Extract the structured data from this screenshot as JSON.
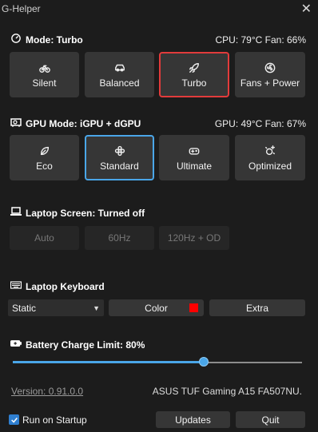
{
  "window": {
    "title": "G-Helper",
    "close_glyph": "✕"
  },
  "mode": {
    "header": "Mode: Turbo",
    "status": "CPU: 79°C Fan: 66%",
    "buttons": [
      {
        "label": "Silent",
        "icon": "bicycle-icon"
      },
      {
        "label": "Balanced",
        "icon": "car-icon"
      },
      {
        "label": "Turbo",
        "icon": "rocket-icon",
        "selected": true
      },
      {
        "label": "Fans + Power",
        "icon": "fan-icon"
      }
    ]
  },
  "gpu": {
    "header": "GPU Mode: iGPU + dGPU",
    "status": "GPU: 49°C Fan: 67%",
    "buttons": [
      {
        "label": "Eco",
        "icon": "leaf-icon"
      },
      {
        "label": "Standard",
        "icon": "flower-icon",
        "selected": true
      },
      {
        "label": "Ultimate",
        "icon": "gamepad-icon"
      },
      {
        "label": "Optimized",
        "icon": "sparkle-icon"
      }
    ]
  },
  "screen": {
    "header": "Laptop Screen: Turned off",
    "buttons": [
      {
        "label": "Auto"
      },
      {
        "label": "60Hz"
      },
      {
        "label": "120Hz + OD"
      }
    ]
  },
  "keyboard": {
    "header": "Laptop Keyboard",
    "mode_value": "Static",
    "color_label": "Color",
    "color_swatch": "#ff0000",
    "extra_label": "Extra"
  },
  "battery": {
    "header": "Battery Charge Limit: 80%",
    "limit_percent": 80
  },
  "footer": {
    "version": "Version: 0.91.0.0",
    "model": "ASUS TUF Gaming A15 FA507NU.",
    "startup_label": "Run on Startup",
    "startup_checked": true,
    "updates_label": "Updates",
    "quit_label": "Quit"
  },
  "colors": {
    "accent_blue": "#4aa6e8",
    "turbo_red": "#e23b3b",
    "background": "#1c1c1c"
  }
}
